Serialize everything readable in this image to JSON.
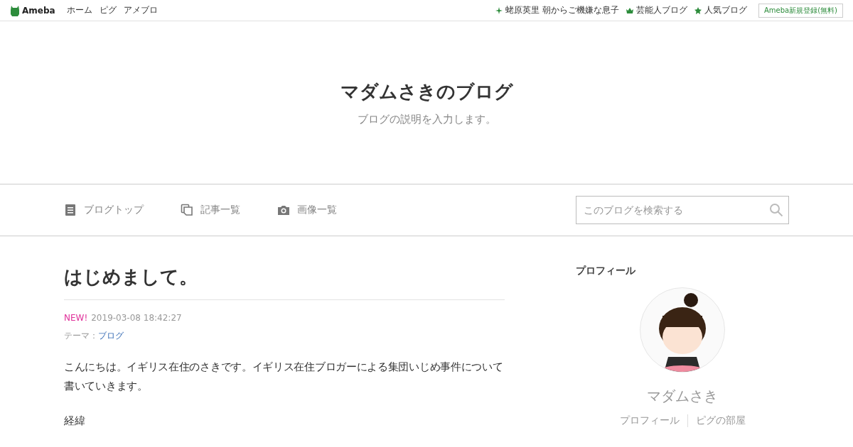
{
  "top_bar": {
    "logo": "Ameba",
    "links": [
      "ホーム",
      "ピグ",
      "アメブロ"
    ],
    "right_links": [
      {
        "kind": "sparkle",
        "label": "蛯原英里 朝からご機嫌な息子"
      },
      {
        "kind": "crown",
        "label": "芸能人ブログ"
      },
      {
        "kind": "star",
        "label": "人気ブログ"
      }
    ],
    "signup": "Ameba新規登録(無料)"
  },
  "blog": {
    "title": "マダムさきのブログ",
    "description": "ブログの説明を入力します。"
  },
  "nav": [
    {
      "kind": "doc",
      "label": "ブログトップ"
    },
    {
      "kind": "pages",
      "label": "記事一覧"
    },
    {
      "kind": "camera",
      "label": "画像一覧"
    }
  ],
  "search": {
    "placeholder": "このブログを検索する"
  },
  "article": {
    "title": "はじめまして。",
    "badge": "NEW!",
    "date": "2019-03-08 18:42:27",
    "theme_label": "テーマ：",
    "theme": "ブログ",
    "paragraphs": [
      "こんにちは。イギリス在住のさきです。イギリス在住ブロガーによる集団いじめ事件について書いていきます。",
      "経緯"
    ]
  },
  "profile": {
    "heading": "プロフィール",
    "name": "マダムさき",
    "links": [
      "プロフィール",
      "ピグの部屋"
    ]
  }
}
